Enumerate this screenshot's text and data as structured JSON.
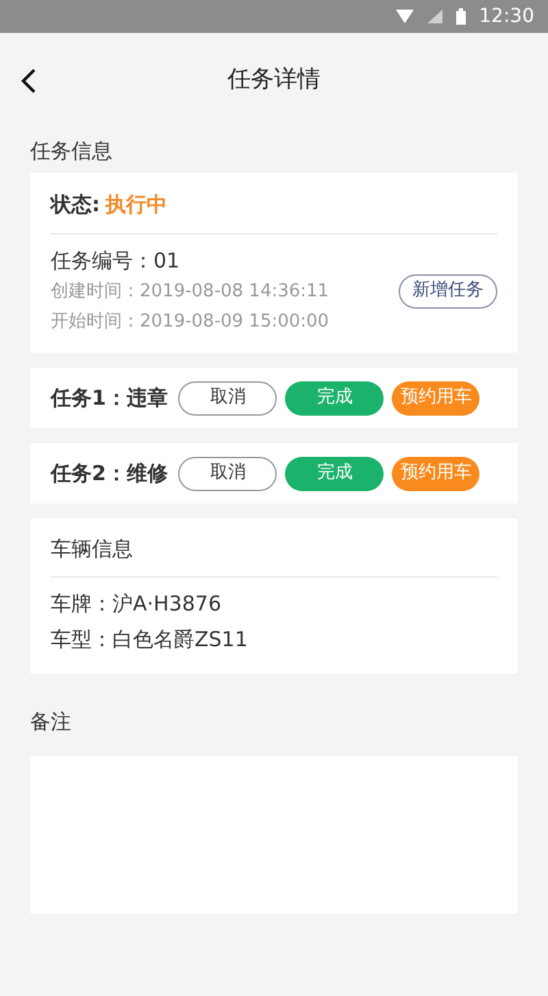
{
  "status_bar": {
    "time": "12:30"
  },
  "header": {
    "title": "任务详情"
  },
  "task_info": {
    "section_title": "任务信息",
    "status_label": "状态:",
    "status_value": "执行中",
    "number": "任务编号：01",
    "created": "创建时间：2019-08-08 14:36:11",
    "started": "开始时间：2019-08-09 15:00:00",
    "add_button": "新增任务"
  },
  "tasks": [
    {
      "label": "任务1：违章",
      "buttons": [
        {
          "kind": "outline",
          "label": "取消"
        },
        {
          "kind": "green",
          "label": "完成"
        },
        {
          "kind": "orange",
          "label": "预约用车"
        }
      ]
    },
    {
      "label": "任务2：维修",
      "buttons": [
        {
          "kind": "outline",
          "label": "取消"
        },
        {
          "kind": "green",
          "label": "完成"
        },
        {
          "kind": "orange",
          "label": "预约用车"
        }
      ]
    }
  ],
  "vehicle": {
    "title": "车辆信息",
    "plate": "车牌：沪A·H3876",
    "model": "车型：白色名爵ZS11"
  },
  "remarks": {
    "title": "备注"
  }
}
